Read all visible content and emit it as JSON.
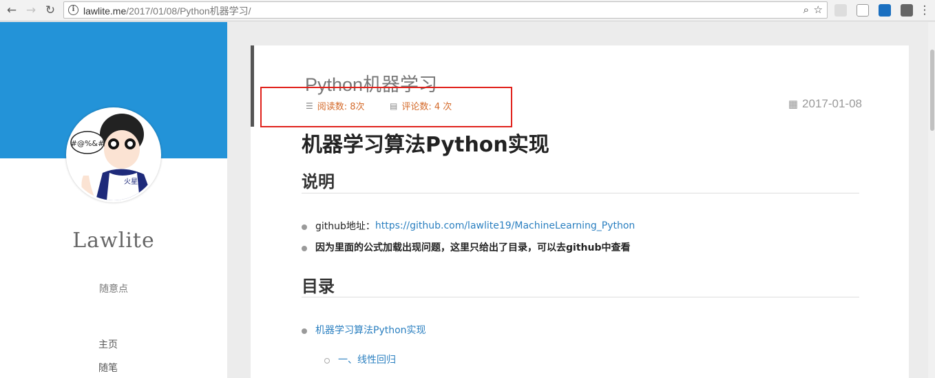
{
  "browser": {
    "url_host": "lawlite.me",
    "url_path": "/2017/01/08/Python机器学习/",
    "back_icon": "arrow-left",
    "forward_icon": "arrow-right",
    "reload_icon": "reload"
  },
  "sidebar": {
    "site_name": "Lawlite",
    "tagline": "随意点",
    "nav": [
      "主页",
      "随笔"
    ],
    "avatar_text": "#@%&#",
    "avatar_badge": "火星族"
  },
  "post": {
    "title": "Python机器学习",
    "views": "阅读数: 8次",
    "comments": "评论数: 4 次",
    "date": "2017-01-08",
    "h1": "机器学习算法Python实现",
    "section1": "说明",
    "item1_label": "github地址：",
    "item1_link": "https://github.com/lawlite19/MachineLearning_Python",
    "item2": "因为里面的公式加载出现问题，这里只给出了目录，可以去github中查看",
    "section2": "目录",
    "toc1": "机器学习算法Python实现",
    "toc1_1": "一、线性回归"
  },
  "colors": {
    "sidebar_banner": "#2393d8",
    "meta_orange": "#d46a2a",
    "link_blue": "#2a7fc0",
    "highlight_red": "#e0201a"
  }
}
